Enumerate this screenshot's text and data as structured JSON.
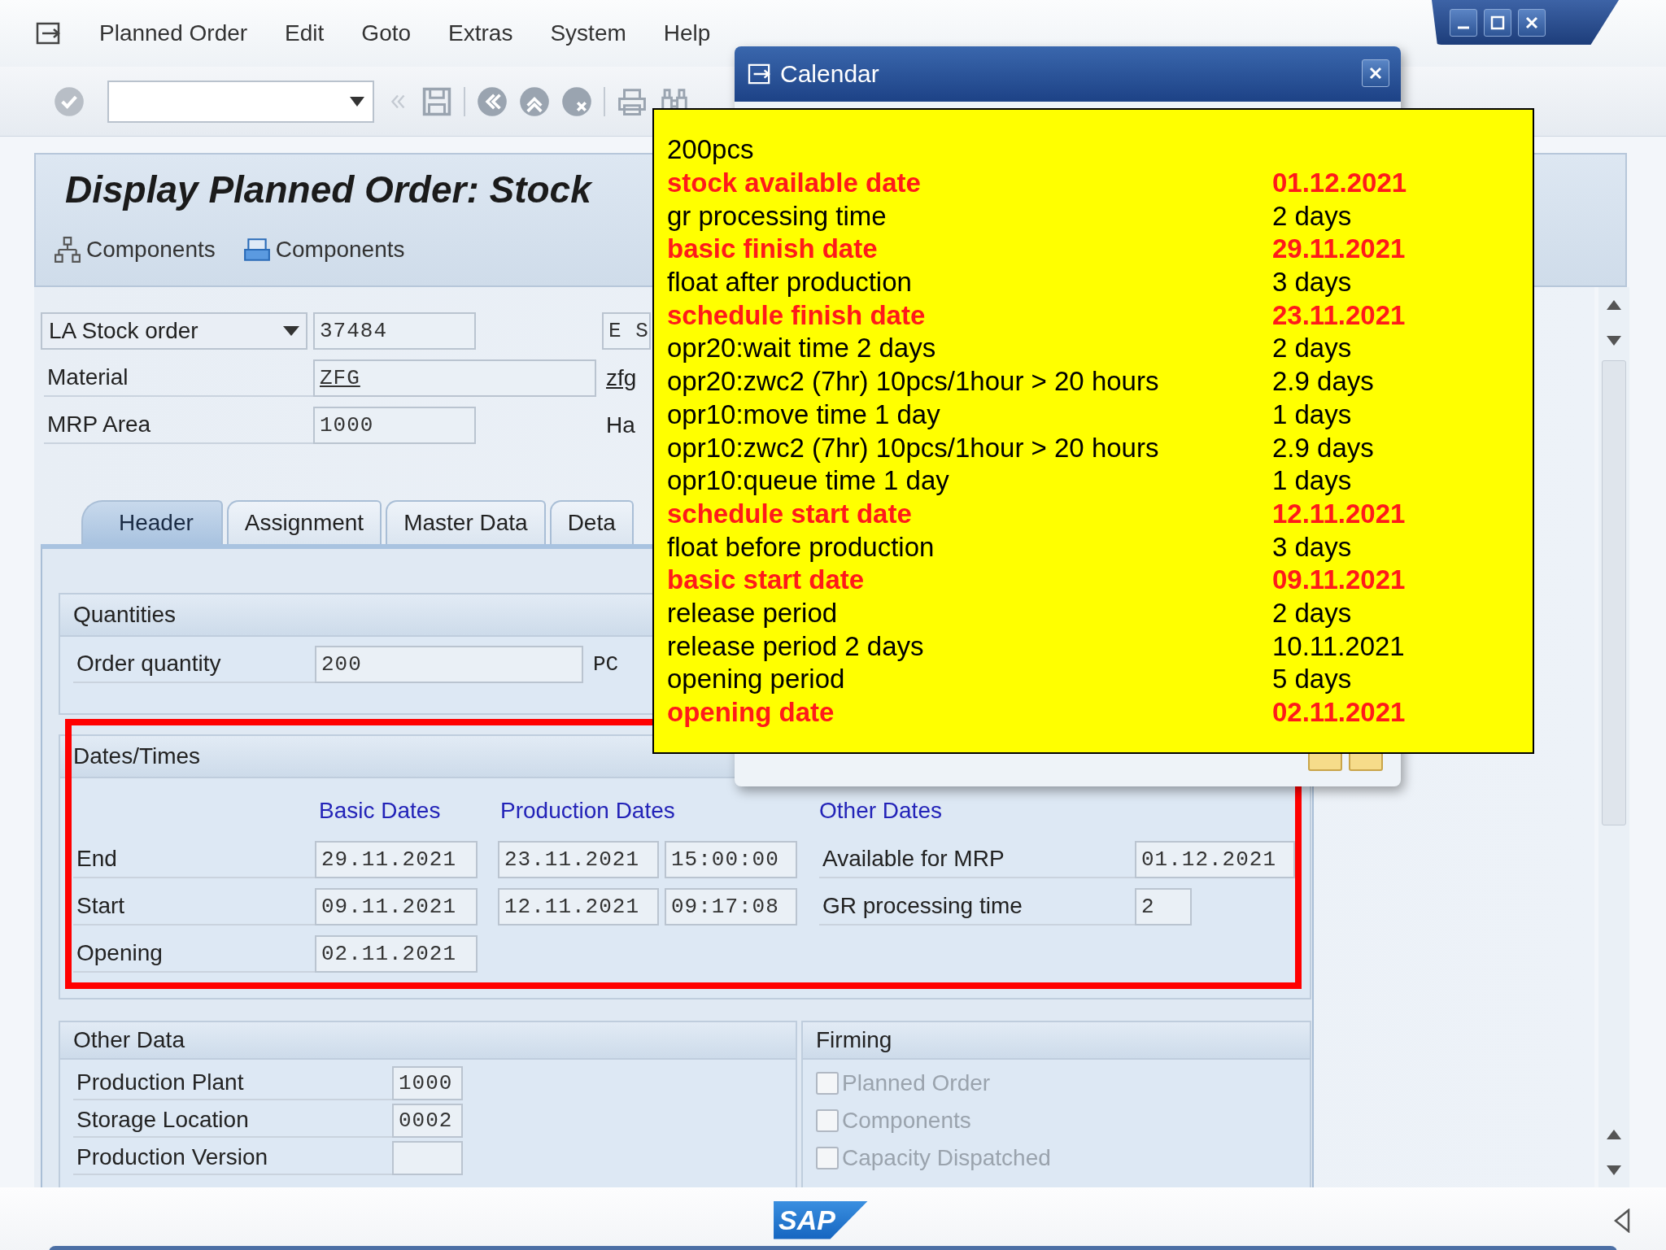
{
  "menu": [
    "Planned Order",
    "Edit",
    "Goto",
    "Extras",
    "System",
    "Help"
  ],
  "title": "Display Planned Order: Stock",
  "app_toolbar": [
    "Components",
    "Components"
  ],
  "header": {
    "order_type": "LA Stock order",
    "order_number": "37484",
    "side_field": "E S",
    "material_label": "Material",
    "material": "ZFG",
    "material_link": "zfg",
    "mrp_area_label": "MRP Area",
    "mrp_area": "1000",
    "side_text": "Ha"
  },
  "tabs": [
    {
      "label": "Header",
      "selected": true
    },
    {
      "label": "Assignment",
      "selected": false
    },
    {
      "label": "Master Data",
      "selected": false
    },
    {
      "label": "Deta",
      "selected": false
    }
  ],
  "quantities": {
    "title": "Quantities",
    "label": "Order quantity",
    "value": "200",
    "unit": "PC"
  },
  "dates": {
    "title": "Dates/Times",
    "columns": [
      "Basic Dates",
      "Production Dates",
      "Other Dates"
    ],
    "rows": [
      {
        "label": "End",
        "basic": "29.11.2021",
        "production_date": "23.11.2021",
        "production_time": "15:00:00",
        "other_label": "Available for MRP",
        "other_value": "01.12.2021"
      },
      {
        "label": "Start",
        "basic": "09.11.2021",
        "production_date": "12.11.2021",
        "production_time": "09:17:08",
        "other_label": "GR processing time",
        "other_value": "2"
      },
      {
        "label": "Opening",
        "basic": "02.11.2021"
      }
    ]
  },
  "other_data": {
    "title": "Other Data",
    "rows": [
      {
        "label": "Production Plant",
        "value": "1000"
      },
      {
        "label": "Storage Location",
        "value": "0002"
      },
      {
        "label": "Production Version"
      }
    ]
  },
  "firming": {
    "title": "Firming",
    "options": [
      {
        "label": "Planned Order",
        "checked": false,
        "disabled": true
      },
      {
        "label": "Components",
        "checked": false,
        "disabled": true
      },
      {
        "label": "Capacity Dispatched",
        "checked": false,
        "disabled": true
      }
    ]
  },
  "dialog": {
    "title": "Calendar"
  },
  "note": {
    "rows": [
      {
        "text": "200pcs",
        "emphasis": false
      },
      {
        "text": "stock available date",
        "value": "01.12.2021",
        "emphasis": true
      },
      {
        "text": "gr processing time",
        "value": "2 days",
        "emphasis": false
      },
      {
        "text": "basic finish date",
        "value": "29.11.2021",
        "emphasis": true
      },
      {
        "text": "float after production",
        "value": "3 days",
        "emphasis": false
      },
      {
        "text": "schedule finish date",
        "value": "23.11.2021",
        "emphasis": true
      },
      {
        "text": "opr20:wait time 2 days",
        "value": "2 days",
        "emphasis": false
      },
      {
        "text": "opr20:zwc2 (7hr) 10pcs/1hour > 20 hours",
        "value": "2.9 days",
        "emphasis": false
      },
      {
        "text": "opr10:move time 1 day",
        "value": "1 days",
        "emphasis": false
      },
      {
        "text": "opr10:zwc2 (7hr) 10pcs/1hour > 20 hours",
        "value": "2.9 days",
        "emphasis": false
      },
      {
        "text": "opr10:queue time 1 day",
        "value": "1 days",
        "emphasis": false
      },
      {
        "text": "schedule start date",
        "value": "12.11.2021",
        "emphasis": true
      },
      {
        "text": "float before production",
        "value": "3 days",
        "emphasis": false
      },
      {
        "text": "basic start date",
        "value": "09.11.2021",
        "emphasis": true
      },
      {
        "text": "release period",
        "value": "2 days",
        "emphasis": false
      },
      {
        "text": "release period 2 days",
        "value": "10.11.2021",
        "emphasis": false
      },
      {
        "text": "opening period",
        "value": "5 days",
        "emphasis": false
      },
      {
        "text": "opening date",
        "value": "02.11.2021",
        "emphasis": true
      }
    ]
  },
  "status_bar": {
    "logo": "SAP"
  }
}
